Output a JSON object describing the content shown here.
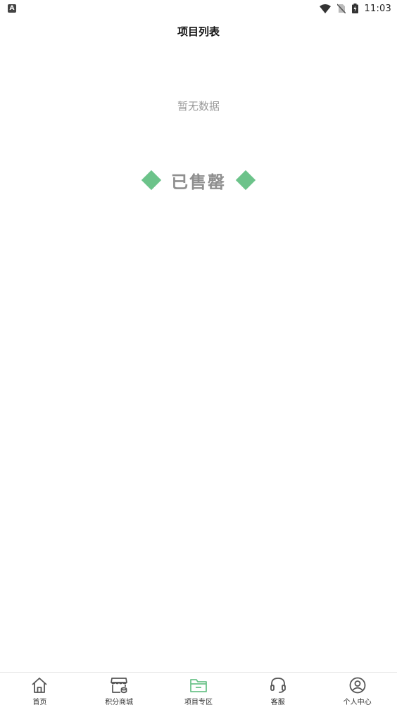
{
  "status_bar": {
    "app_badge": "A",
    "time": "11:03"
  },
  "header": {
    "title": "项目列表"
  },
  "empty_state": {
    "message": "暂无数据"
  },
  "banner": {
    "text": "已售罄",
    "accent_color": "#6cc38a"
  },
  "tabbar": {
    "active_color": "#6cc38a",
    "items": [
      {
        "label": "首页",
        "icon": "home-icon"
      },
      {
        "label": "积分商城",
        "icon": "store-icon"
      },
      {
        "label": "项目专区",
        "icon": "folder-icon"
      },
      {
        "label": "客服",
        "icon": "headset-icon"
      },
      {
        "label": "个人中心",
        "icon": "user-icon"
      }
    ],
    "active_index": 2
  }
}
